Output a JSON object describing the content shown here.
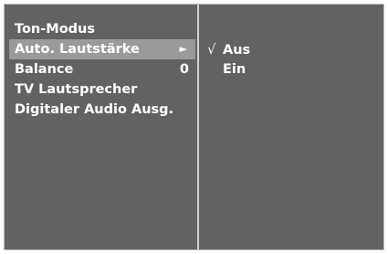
{
  "menu": {
    "title": "Ton-Modus",
    "items": [
      {
        "label": "Auto. Lautstärke",
        "value": "►"
      },
      {
        "label": "Balance",
        "value": "0"
      },
      {
        "label": "TV Lautsprecher",
        "value": ""
      },
      {
        "label": "Digitaler Audio Ausg.",
        "value": ""
      }
    ]
  },
  "submenu": {
    "items": [
      {
        "check": "√",
        "label": "Aus"
      },
      {
        "check": "",
        "label": "Ein"
      }
    ]
  },
  "colors": {
    "panel": "#626262",
    "highlight": "#9a9a9a",
    "divider": "#d4d4d4",
    "text": "#ffffff"
  }
}
